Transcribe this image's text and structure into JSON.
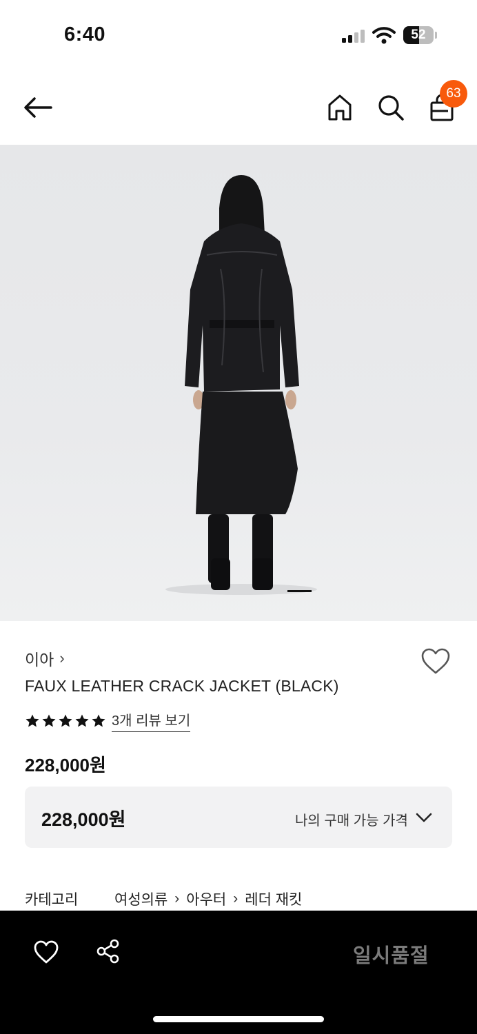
{
  "status_bar": {
    "time": "6:40",
    "battery_level": "52",
    "battery_fraction": 0.52,
    "icons": [
      "cellular-signal-icon",
      "wifi-icon",
      "battery-icon"
    ]
  },
  "nav": {
    "icons": [
      "back-arrow-icon",
      "home-icon",
      "search-icon",
      "shopping-bag-icon"
    ],
    "cart_count": "63",
    "badge_color": "#f85a0c"
  },
  "product": {
    "brand": "이아",
    "brand_chevron": "›",
    "name": "FAUX LEATHER CRACK JACKET (BLACK)",
    "rating_stars": 5,
    "review_link": "3개 리뷰 보기",
    "price": "228,000원",
    "image_count_indicator": "1"
  },
  "price_box": {
    "value": "228,000원",
    "label": "나의 구매 가능 가격"
  },
  "category": {
    "label": "카테고리",
    "path": [
      "여성의류",
      "아우터",
      "레더 재킷"
    ],
    "separator": "›"
  },
  "bottom_bar": {
    "soldout_label": "일시품절",
    "icons": [
      "heart-icon",
      "share-icon"
    ],
    "soldout_color": "#7b7b7b"
  }
}
